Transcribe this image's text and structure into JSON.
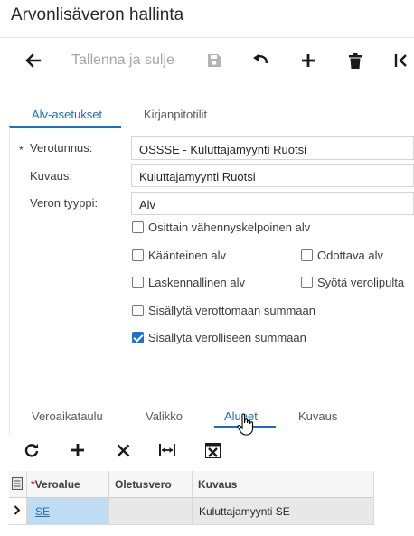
{
  "window": {
    "title": "Arvonlisäveron hallinta"
  },
  "toolbar": {
    "back_icon": "arrow-left-icon",
    "save_close_label": "Tallenna ja sulje",
    "save_icon": "floppy-disk-icon",
    "undo_icon": "undo-icon",
    "add_icon": "plus-icon",
    "delete_icon": "trash-icon",
    "first_icon": "first-page-icon"
  },
  "tabs": [
    {
      "label": "Alv-asetukset",
      "active": true
    },
    {
      "label": "Kirjanpitotilit",
      "active": false
    }
  ],
  "form": {
    "required_mark": "*",
    "verotunnus": {
      "label": "Verotunnus:",
      "value": "OSSSE - Kuluttajamyynti Ruotsi"
    },
    "kuvaus": {
      "label": "Kuvaus:",
      "value": "Kuluttajamyynti Ruotsi"
    },
    "veron_tyyppi": {
      "label": "Veron tyyppi:",
      "value": "Alv"
    },
    "checkboxes": [
      {
        "label": "Osittain vähennyskelpoinen alv",
        "checked": false
      },
      {
        "label": "Käänteinen alv",
        "checked": false
      },
      {
        "label": "Odottava alv",
        "checked": false
      },
      {
        "label": "Laskennallinen alv",
        "checked": false
      },
      {
        "label": "Syötä verolipulta",
        "checked": false
      },
      {
        "label": "Sisällytä verottomaan summaan",
        "checked": false
      },
      {
        "label": "Sisällytä verolliseen summaan",
        "checked": true
      }
    ]
  },
  "bottom_tabs": [
    {
      "label": "Veroaikataulu",
      "active": false
    },
    {
      "label": "Valikko",
      "active": false
    },
    {
      "label": "Alueet",
      "active": true
    },
    {
      "label": "Kuvaus",
      "active": false
    }
  ],
  "grid_toolbar": {
    "refresh_icon": "refresh-icon",
    "add_icon": "plus-icon",
    "delete_icon": "close-icon",
    "fit_icon": "fit-columns-icon",
    "export_icon": "excel-export-icon"
  },
  "grid": {
    "columns": [
      "Veroalue",
      "Oletusvero",
      "Kuvaus"
    ],
    "required_mark": "*",
    "rows": [
      {
        "veroalue": "SE",
        "oletusvero": "",
        "kuvaus": "Kuluttajamyynti SE"
      }
    ]
  },
  "colors": {
    "accent": "#1f6fb5",
    "checkbox": "#1a73c9",
    "selected_cell": "#bfdcf3"
  }
}
